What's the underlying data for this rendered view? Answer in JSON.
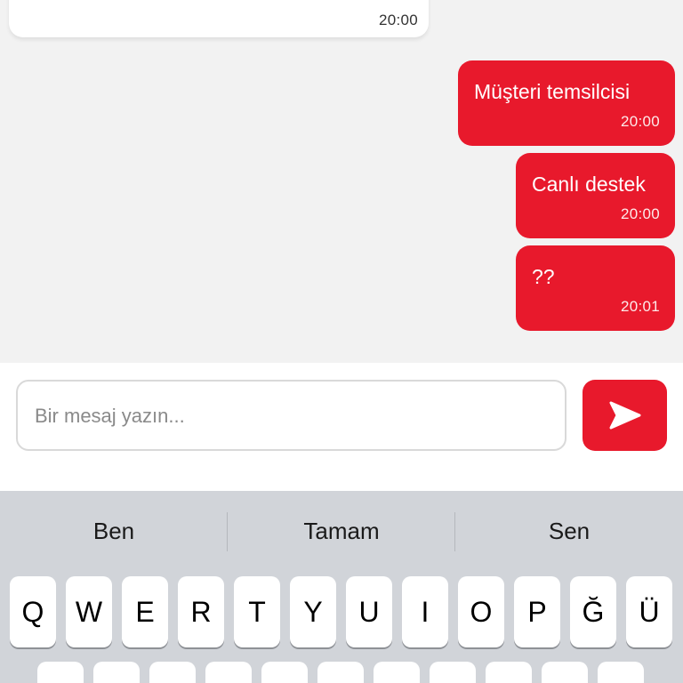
{
  "messages": {
    "incoming_time": "20:00",
    "outgoing": [
      {
        "text": "Müşteri temsilcisi",
        "time": "20:00"
      },
      {
        "text": "Canlı destek",
        "time": "20:00"
      },
      {
        "text": "??",
        "time": "20:01"
      }
    ]
  },
  "composer": {
    "placeholder": "Bir mesaj yazın...",
    "send_icon": "send-arrow-icon"
  },
  "keyboard": {
    "suggestions": [
      "Ben",
      "Tamam",
      "Sen"
    ],
    "row1": [
      "Q",
      "W",
      "E",
      "R",
      "T",
      "Y",
      "U",
      "I",
      "O",
      "P",
      "Ğ",
      "Ü"
    ]
  },
  "colors": {
    "accent": "#e8192c",
    "chat_bg": "#f2f2f2",
    "keyboard_bg": "#d1d4d9"
  }
}
